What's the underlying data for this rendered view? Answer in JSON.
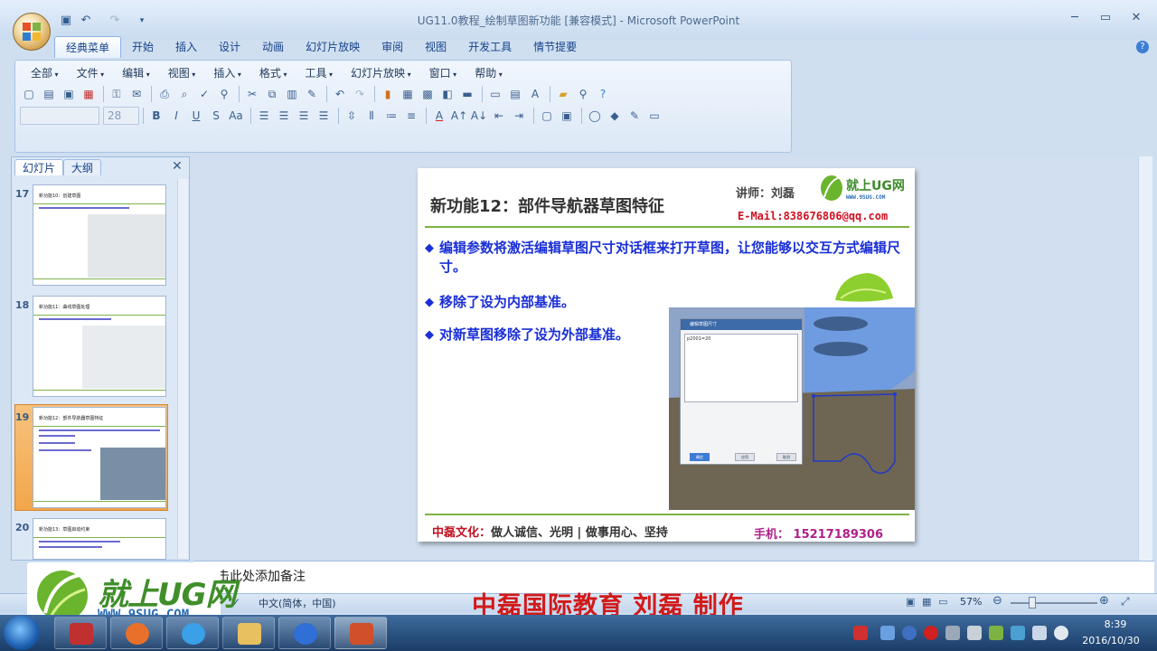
{
  "app": {
    "title": "UG11.0教程_绘制草图新功能 [兼容模式] - Microsoft PowerPoint"
  },
  "tabs": [
    "经典菜单",
    "开始",
    "插入",
    "设计",
    "动画",
    "幻灯片放映",
    "审阅",
    "视图",
    "开发工具",
    "情节提要"
  ],
  "menu": [
    "全部",
    "文件",
    "编辑",
    "视图",
    "插入",
    "格式",
    "工具",
    "幻灯片放映",
    "窗口",
    "帮助"
  ],
  "toolbar": {
    "font_size": "28"
  },
  "pane": {
    "tab_slides": "幻灯片",
    "tab_outline": "大纲",
    "close": "✕"
  },
  "thumbnails": [
    {
      "num": "17",
      "title": "新功能10：创建草图"
    },
    {
      "num": "18",
      "title": "新功能11：曲线草图处理"
    },
    {
      "num": "19",
      "title": "新功能12：部件导航器草图特征"
    },
    {
      "num": "20",
      "title": "新功能13：草图启动约束"
    }
  ],
  "slide": {
    "title": "新功能12：部件导航器草图特征",
    "teacher": "讲师：刘磊",
    "logo_text": "就上UG网",
    "logo_site": "WWW.9SUG.COM",
    "email": "E-Mail:838676806@qq.com",
    "bullets": [
      "编辑参数将激活编辑草图尺寸对话框来打开草图，让您能够以交互方式编辑尺寸。",
      "移除了设为内部基准。",
      "对新草图移除了设为外部基准。"
    ],
    "footer_label": "中磊文化：",
    "footer_text": "做人诚信、光明 | 做事用心、坚持",
    "phone": "手机： 15217189306",
    "dialog_title": "编辑草图尺寸",
    "dialog_value": "p2001=20",
    "dialog_ok": "确定",
    "dialog_apply": "应用",
    "dialog_cancel": "取消"
  },
  "notes": {
    "placeholder": "击此处添加备注"
  },
  "status": {
    "language": "中文(简体，中国)",
    "zoom": "57%"
  },
  "watermark": {
    "name": "就上UG网",
    "site": "WWW.9SUG.COM",
    "credit": "中磊国际教育 刘磊 制作"
  },
  "clock": {
    "time": "8:39",
    "date": "2016/10/30"
  },
  "colors": {
    "bullet_blue": "#1a2fd6",
    "accent_green": "#7cb342",
    "credit_red": "#d21919"
  }
}
